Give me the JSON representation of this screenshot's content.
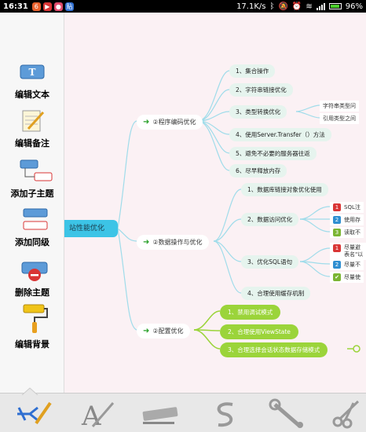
{
  "status": {
    "time": "16:31",
    "speed": "17.1K/s",
    "battery": "96%",
    "notif_icons": [
      {
        "name": "notif-app-icon-1",
        "color": "#e8602c",
        "glyph": "6"
      },
      {
        "name": "notif-app-icon-2",
        "color": "#d93535",
        "glyph": "▶"
      },
      {
        "name": "notif-app-icon-3",
        "color": "#e04b6b",
        "glyph": "●"
      },
      {
        "name": "notif-app-icon-4",
        "color": "#2f6fd1",
        "glyph": "贴"
      }
    ]
  },
  "sidebar": {
    "items": [
      {
        "label": "编辑文本",
        "icon": "text-box-icon"
      },
      {
        "label": "编辑备注",
        "icon": "notepad-pencil-icon"
      },
      {
        "label": "添加子主题",
        "icon": "add-child-topic-icon"
      },
      {
        "label": "添加同级",
        "icon": "add-sibling-topic-icon"
      },
      {
        "label": "删除主题",
        "icon": "delete-topic-icon"
      },
      {
        "label": "编辑背景",
        "icon": "paint-roller-icon"
      }
    ]
  },
  "mindmap": {
    "central": "站性能优化",
    "branches": [
      {
        "label": "②程序编码优化",
        "children": [
          "1、集合操作",
          "2、字符串链接优化",
          "3、类型转换优化",
          "4、使用Server.Transfer（）方法",
          "5、避免不必要的服务器往返",
          "6、尽早释放内存"
        ],
        "grandchildren": [
          "字符串类型问",
          "引用类型之间"
        ]
      },
      {
        "label": "②数据操作与优化",
        "children": [
          "1、数据库链接对象优化使用",
          "2、数据访问优化",
          "3、优化SQL语句",
          "4、合理使用缓存机制"
        ],
        "data_access_items": [
          {
            "badge": "1",
            "color": "#d93535",
            "text": "SQL注"
          },
          {
            "badge": "2",
            "color": "#2f8fd1",
            "text": "使用存"
          },
          {
            "badge": "3",
            "color": "#7bb533",
            "text": "读取不"
          }
        ],
        "sql_items": [
          {
            "badge": "1",
            "color": "#d93535",
            "text": "尽量避"
          },
          {
            "badge": "",
            "color": "",
            "text": "表名\"以"
          },
          {
            "badge": "2",
            "color": "#2f8fd1",
            "text": "尽量不"
          },
          {
            "badge": "✔",
            "color": "#7bb533",
            "text": "尽量使"
          }
        ]
      },
      {
        "label": "②配置优化",
        "children": [
          "1、禁用调试模式",
          "2、合理使用ViewState",
          "3、合理选择会话状态数据存储模式"
        ]
      }
    ]
  },
  "bottombar": {
    "tools": [
      {
        "icon": "mindmap-edit-icon"
      },
      {
        "icon": "font-style-icon"
      },
      {
        "icon": "marker-pen-icon"
      },
      {
        "icon": "relationship-curve-icon"
      },
      {
        "icon": "wrench-icon"
      },
      {
        "icon": "scissors-icon"
      }
    ]
  }
}
